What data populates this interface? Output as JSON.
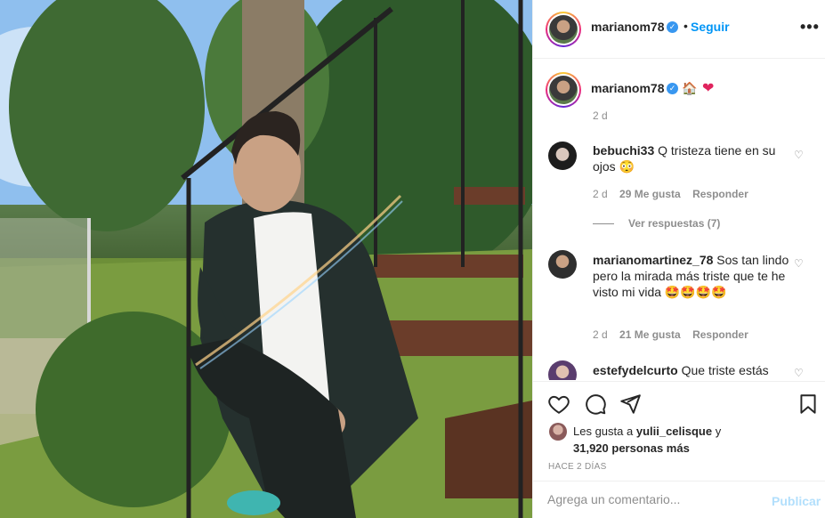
{
  "post": {
    "username": "marianom78",
    "follow_label": "Seguir",
    "dot": "•",
    "more_icon": "more-horizontal-icon",
    "verified_glyph": "✓"
  },
  "caption": {
    "username": "marianom78",
    "emoji_house": "🏠",
    "emoji_heart": "❤",
    "age": "2 d"
  },
  "comments": [
    {
      "username": "bebuchi33",
      "text": "Q tristeza tiene en su ojos 😳",
      "age": "2 d",
      "likes": "29 Me gusta",
      "reply": "Responder",
      "view_replies": "Ver respuestas (7)"
    },
    {
      "username": "marianomartinez_78",
      "text": "Sos tan lindo pero la mirada más triste que te he visto mi vida 🤩🤩🤩🤩",
      "age": "2 d",
      "likes": "21 Me gusta",
      "reply": "Responder"
    },
    {
      "username": "estefydelcurto",
      "text": "Que triste estás"
    }
  ],
  "likes": {
    "prefix": "Les gusta a",
    "user": "yulii_celisque",
    "conj": "y",
    "count": "31,920 personas más"
  },
  "time_ago": "HACE 2 DÍAS",
  "add_comment": {
    "placeholder": "Agrega un comentario...",
    "publish": "Publicar"
  },
  "colors": {
    "accent": "#0095f6",
    "verified": "#3897f0",
    "heart": "#e0245e",
    "muted": "#8e8e8e"
  }
}
